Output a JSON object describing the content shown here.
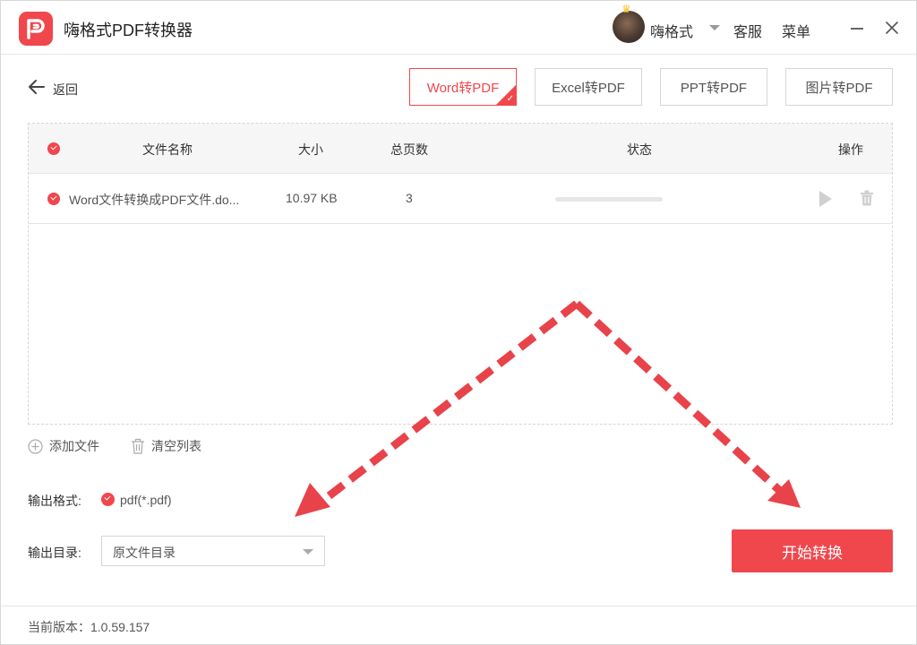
{
  "app": {
    "title": "嗨格式PDF转换器"
  },
  "header": {
    "username": "嗨格式",
    "service": "客服",
    "menu": "菜单"
  },
  "nav": {
    "back_label": "返回"
  },
  "mode_tabs": [
    {
      "label": "Word转PDF",
      "active": true
    },
    {
      "label": "Excel转PDF",
      "active": false
    },
    {
      "label": "PPT转PDF",
      "active": false
    },
    {
      "label": "图片转PDF",
      "active": false
    }
  ],
  "table": {
    "columns": {
      "name": "文件名称",
      "size": "大小",
      "pages": "总页数",
      "status": "状态",
      "actions": "操作"
    },
    "rows": [
      {
        "name": "Word文件转换成PDF文件.do...",
        "size": "10.97 KB",
        "pages": "3",
        "progress": 0
      }
    ]
  },
  "list_actions": {
    "add_file": "添加文件",
    "clear_list": "清空列表"
  },
  "output": {
    "format_label": "输出格式:",
    "format_value": "pdf(*.pdf)",
    "dir_label": "输出目录:",
    "dir_value": "原文件目录"
  },
  "start_button": "开始转换",
  "footer": {
    "version": "当前版本：1.0.59.157"
  },
  "colors": {
    "accent": "#f0474d",
    "annotation_arrow": "#e8434a"
  },
  "icons": [
    "logo-icon",
    "crown-icon",
    "chevron-down-icon",
    "minimize-icon",
    "close-icon",
    "arrow-left-icon",
    "check-icon",
    "play-icon",
    "trash-icon",
    "plus-circle-icon"
  ]
}
